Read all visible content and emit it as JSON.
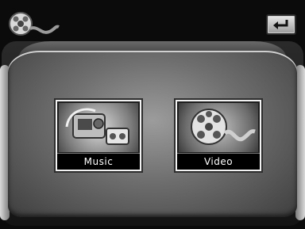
{
  "header": {
    "app_icon": "film-reel-icon",
    "back_icon": "return-arrow-icon"
  },
  "menu": {
    "items": [
      {
        "label": "Music",
        "icon": "music-player-icon"
      },
      {
        "label": "Video",
        "icon": "film-reel-icon"
      }
    ]
  }
}
